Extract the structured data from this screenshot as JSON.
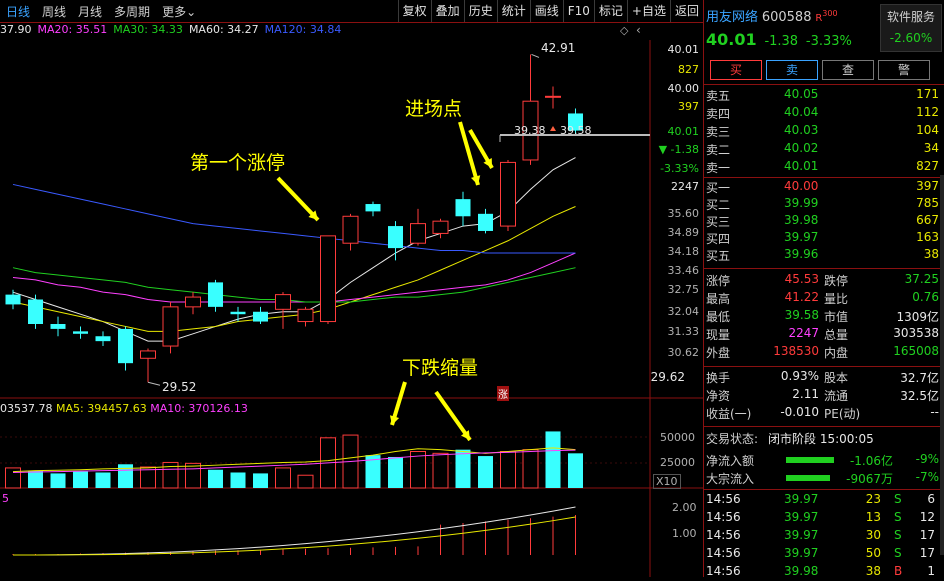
{
  "toolbar": {
    "tabs": [
      "日线",
      "周线",
      "月线",
      "多周期",
      "更多"
    ],
    "buttons": [
      "复权",
      "叠加",
      "历史",
      "统计",
      "画线",
      "F10",
      "标记",
      "+自选",
      "返回"
    ]
  },
  "ma_legend": [
    {
      "label": "37.90",
      "color": "#e8e8e8"
    },
    {
      "label": "MA20: 35.51",
      "color": "#ff40ff"
    },
    {
      "label": "MA30: 34.33",
      "color": "#20d020"
    },
    {
      "label": "MA60: 34.27",
      "color": "#e8e8e8"
    },
    {
      "label": "MA120: 34.84",
      "color": "#3a5aff"
    }
  ],
  "annotations": {
    "first_limit": "第一个涨停",
    "entry_point": "进场点",
    "decline_volume": "下跌缩量"
  },
  "price_labels": {
    "high": "42.91",
    "low": "29.52",
    "box_left": "39.38",
    "box_right": "39.58",
    "limit_badge": "涨"
  },
  "price_axis": [
    "40.01",
    "827",
    "40.00",
    "397",
    "40.01",
    "▼ -1.38",
    "-3.33%",
    "2247",
    "35.60",
    "34.89",
    "34.18",
    "33.46",
    "32.75",
    "32.04",
    "31.33",
    "30.62",
    "29.62"
  ],
  "volume_legend": {
    "vol": "03537.78",
    "ma5": "MA5: 394457.63",
    "ma10": "MA10: 370126.13"
  },
  "volume_axis": [
    "50000",
    "25000",
    "X10"
  ],
  "indicator_axis": [
    "2.00",
    "1.00"
  ],
  "indicator_label": "5",
  "stock": {
    "name": "用友网络",
    "code": "600588",
    "tag": "R",
    "tag_num": "300",
    "price": "40.01",
    "change": "-1.38",
    "change_pct": "-3.33%",
    "sector": "软件服务",
    "sector_pct": "-2.60%"
  },
  "trade_buttons": [
    "买",
    "卖",
    "查",
    "警"
  ],
  "asks": [
    {
      "label": "卖五",
      "price": "40.05",
      "vol": "171"
    },
    {
      "label": "卖四",
      "price": "40.04",
      "vol": "112"
    },
    {
      "label": "卖三",
      "price": "40.03",
      "vol": "104"
    },
    {
      "label": "卖二",
      "price": "40.02",
      "vol": "34"
    },
    {
      "label": "卖一",
      "price": "40.01",
      "vol": "827"
    }
  ],
  "bids": [
    {
      "label": "买一",
      "price": "40.00",
      "vol": "397"
    },
    {
      "label": "买二",
      "price": "39.99",
      "vol": "785"
    },
    {
      "label": "买三",
      "price": "39.98",
      "vol": "667"
    },
    {
      "label": "买四",
      "price": "39.97",
      "vol": "163"
    },
    {
      "label": "买五",
      "price": "39.96",
      "vol": "38"
    }
  ],
  "stats": [
    {
      "l1": "涨停",
      "v1": "45.53",
      "c1": "red",
      "l2": "跌停",
      "v2": "37.25",
      "c2": "green"
    },
    {
      "l1": "最高",
      "v1": "41.22",
      "c1": "red",
      "l2": "量比",
      "v2": "0.76",
      "c2": "green"
    },
    {
      "l1": "最低",
      "v1": "39.58",
      "c1": "green",
      "l2": "市值",
      "v2": "1309亿",
      "c2": "white"
    },
    {
      "l1": "现量",
      "v1": "2247",
      "c1": "magenta",
      "l2": "总量",
      "v2": "303538",
      "c2": "white"
    },
    {
      "l1": "外盘",
      "v1": "138530",
      "c1": "red",
      "l2": "内盘",
      "v2": "165008",
      "c2": "green"
    }
  ],
  "stats2": [
    {
      "l1": "换手",
      "v1": "0.93%",
      "l2": "股本",
      "v2": "32.7亿"
    },
    {
      "l1": "净资",
      "v1": "2.11",
      "l2": "流通",
      "v2": "32.5亿"
    },
    {
      "l1": "收益(一)",
      "v1": "-0.010",
      "l2": "PE(动)",
      "v2": "--"
    }
  ],
  "trade_status": {
    "label": "交易状态:",
    "value": "闭市阶段 15:00:05"
  },
  "flows": [
    {
      "label": "净流入额",
      "value": "-1.06亿",
      "pct": "-9%"
    },
    {
      "label": "大宗流入",
      "value": "-9067万",
      "pct": "-7%"
    }
  ],
  "ticks": [
    {
      "time": "14:56",
      "price": "39.97",
      "vol": "23",
      "side": "S",
      "n": "6"
    },
    {
      "time": "14:56",
      "price": "39.97",
      "vol": "13",
      "side": "S",
      "n": "12"
    },
    {
      "time": "14:56",
      "price": "39.97",
      "vol": "30",
      "side": "S",
      "n": "17"
    },
    {
      "time": "14:56",
      "price": "39.97",
      "vol": "50",
      "side": "S",
      "n": "17"
    },
    {
      "time": "14:56",
      "price": "39.98",
      "vol": "38",
      "side": "B",
      "n": "1"
    }
  ],
  "chart_data": {
    "type": "candlestick",
    "y_range": [
      29.0,
      43.5
    ],
    "candles": [
      {
        "o": 33.1,
        "h": 33.3,
        "l": 32.5,
        "c": 32.7
      },
      {
        "o": 32.9,
        "h": 33.1,
        "l": 31.7,
        "c": 31.9
      },
      {
        "o": 31.9,
        "h": 32.2,
        "l": 31.4,
        "c": 31.7
      },
      {
        "o": 31.6,
        "h": 31.8,
        "l": 31.3,
        "c": 31.5
      },
      {
        "o": 31.4,
        "h": 31.6,
        "l": 31.0,
        "c": 31.2
      },
      {
        "o": 31.7,
        "h": 31.8,
        "l": 30.0,
        "c": 30.3
      },
      {
        "o": 30.5,
        "h": 30.9,
        "l": 29.52,
        "c": 30.8
      },
      {
        "o": 31.0,
        "h": 32.8,
        "l": 30.7,
        "c": 32.6
      },
      {
        "o": 32.6,
        "h": 33.2,
        "l": 32.3,
        "c": 33.0
      },
      {
        "o": 33.6,
        "h": 33.7,
        "l": 32.4,
        "c": 32.6
      },
      {
        "o": 32.4,
        "h": 32.6,
        "l": 32.0,
        "c": 32.3
      },
      {
        "o": 32.4,
        "h": 32.6,
        "l": 31.9,
        "c": 32.0
      },
      {
        "o": 32.5,
        "h": 33.2,
        "l": 31.7,
        "c": 33.1
      },
      {
        "o": 32.0,
        "h": 32.6,
        "l": 31.8,
        "c": 32.5
      },
      {
        "o": 32.0,
        "h": 35.5,
        "l": 31.9,
        "c": 35.5
      },
      {
        "o": 35.2,
        "h": 36.4,
        "l": 34.9,
        "c": 36.3
      },
      {
        "o": 36.8,
        "h": 36.9,
        "l": 36.3,
        "c": 36.5
      },
      {
        "o": 35.9,
        "h": 36.1,
        "l": 34.5,
        "c": 35.0
      },
      {
        "o": 35.2,
        "h": 36.6,
        "l": 35.1,
        "c": 36.0
      },
      {
        "o": 35.6,
        "h": 36.2,
        "l": 35.4,
        "c": 36.1
      },
      {
        "o": 37.0,
        "h": 37.3,
        "l": 35.9,
        "c": 36.3
      },
      {
        "o": 36.4,
        "h": 36.6,
        "l": 35.6,
        "c": 35.7
      },
      {
        "o": 35.9,
        "h": 38.6,
        "l": 35.7,
        "c": 38.5
      },
      {
        "o": 38.6,
        "h": 42.91,
        "l": 38.4,
        "c": 41.0
      },
      {
        "o": 41.2,
        "h": 41.6,
        "l": 40.7,
        "c": 41.2
      },
      {
        "o": 40.5,
        "h": 40.7,
        "l": 39.58,
        "c": 39.8
      }
    ],
    "volume_range": [
      0,
      80000
    ],
    "volumes": [
      22000,
      19000,
      16000,
      18000,
      17000,
      26000,
      23000,
      28000,
      27000,
      20000,
      17000,
      16000,
      22000,
      14000,
      55000,
      58000,
      36000,
      34000,
      40000,
      38000,
      42000,
      35000,
      40000,
      42000,
      62000,
      38000
    ],
    "volume_up": [
      true,
      false,
      false,
      false,
      false,
      false,
      true,
      true,
      true,
      false,
      false,
      false,
      true,
      true,
      true,
      true,
      false,
      false,
      true,
      true,
      false,
      false,
      true,
      true,
      false,
      false
    ],
    "volume_ma5": [
      18000,
      19000,
      19500,
      20000,
      21000,
      21500,
      22000,
      23500,
      24000,
      25000,
      26000,
      27000,
      28000,
      28500,
      30000,
      33000,
      36000,
      40000,
      43000,
      42000,
      40000,
      38000,
      40000,
      42000,
      44000,
      42000
    ],
    "volume_ma10": [
      17000,
      17500,
      18000,
      18500,
      19000,
      19500,
      20000,
      20500,
      21000,
      22000,
      23000,
      24000,
      25000,
      26000,
      27500,
      29000,
      31000,
      33000,
      35000,
      36500,
      37500,
      38500,
      39000,
      40000,
      41000,
      41500
    ],
    "ma_series": [
      {
        "color": "#e8e8e8",
        "values": [
          33.2,
          32.9,
          32.6,
          32.3,
          32.0,
          31.6,
          31.2,
          31.2,
          31.5,
          31.8,
          32.1,
          32.3,
          32.4,
          32.4,
          32.9,
          33.6,
          34.2,
          34.8,
          35.3,
          35.6,
          35.9,
          36.0,
          36.5,
          37.4,
          38.2,
          38.7
        ]
      },
      {
        "color": "#e8e800",
        "values": [
          32.8,
          32.6,
          32.4,
          32.2,
          32.0,
          31.8,
          31.6,
          31.6,
          31.7,
          31.8,
          32.0,
          32.1,
          32.2,
          32.3,
          32.5,
          32.8,
          33.1,
          33.4,
          33.7,
          34.1,
          34.5,
          34.9,
          35.3,
          35.8,
          36.3,
          36.7
        ]
      },
      {
        "color": "#ff40ff",
        "values": [
          33.8,
          33.7,
          33.5,
          33.4,
          33.2,
          33.1,
          32.9,
          32.8,
          32.8,
          32.8,
          32.8,
          32.8,
          32.8,
          32.8,
          32.8,
          32.9,
          33.0,
          33.1,
          33.2,
          33.3,
          33.4,
          33.5,
          33.7,
          34.0,
          34.4,
          34.8
        ]
      },
      {
        "color": "#20d020",
        "values": [
          34.2,
          34.0,
          33.9,
          33.8,
          33.7,
          33.6,
          33.4,
          33.3,
          33.2,
          33.1,
          33.0,
          32.9,
          32.9,
          32.8,
          32.8,
          32.8,
          32.9,
          33.0,
          33.0,
          33.1,
          33.2,
          33.4,
          33.6,
          33.8,
          34.0,
          34.2
        ]
      },
      {
        "color": "#3a5aff",
        "values": [
          37.6,
          37.4,
          37.2,
          37.0,
          36.8,
          36.6,
          36.4,
          36.2,
          36.0,
          35.9,
          35.8,
          35.7,
          35.6,
          35.5,
          35.4,
          35.3,
          35.2,
          35.1,
          35.0,
          34.9,
          34.9,
          34.8,
          34.8,
          34.8,
          34.8,
          34.8
        ]
      }
    ]
  }
}
